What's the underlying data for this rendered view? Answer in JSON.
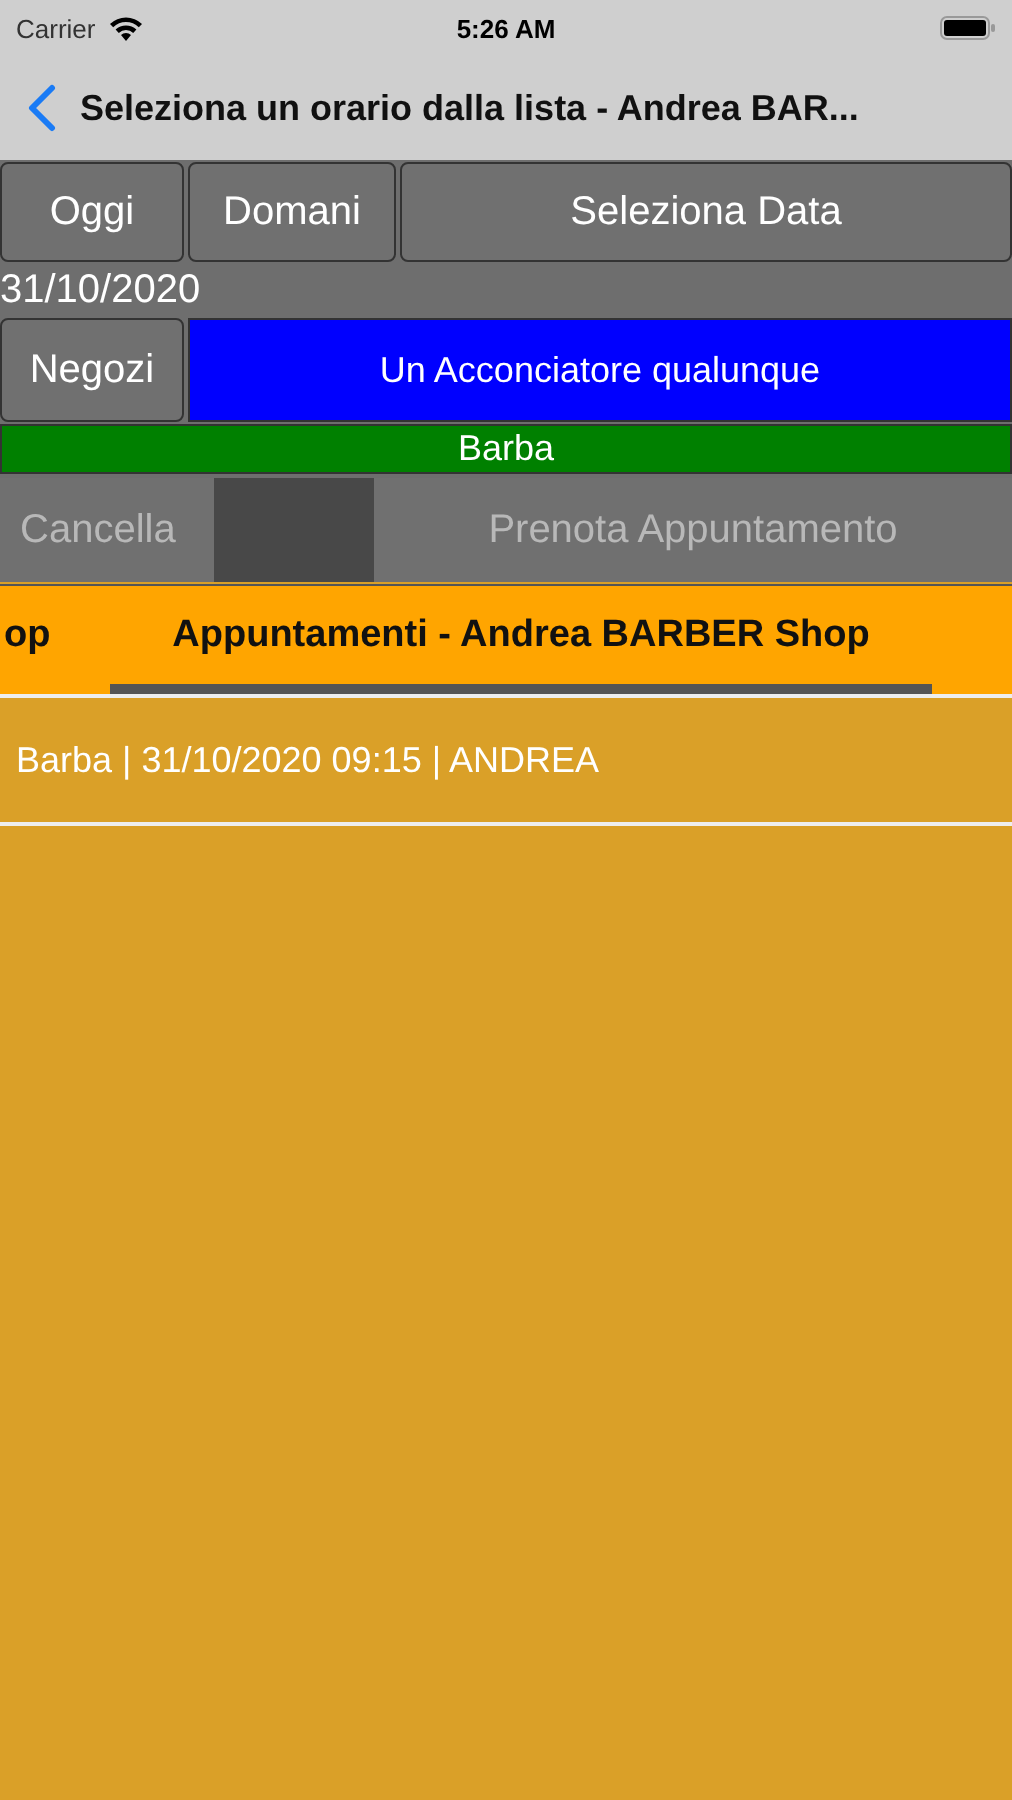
{
  "status_bar": {
    "carrier": "Carrier",
    "time": "5:26 AM"
  },
  "nav": {
    "title": "Seleziona un orario dalla lista - Andrea BAR..."
  },
  "day_buttons": [
    "Oggi",
    "Domani",
    "Seleziona Data"
  ],
  "selected_date": "31/10/2020",
  "shop_button": "Negozi",
  "barber": {
    "label": "Un Acconciatore qualunque",
    "color": "#0000ff"
  },
  "service": {
    "label": "Barba",
    "color": "#008000"
  },
  "actions": [
    {
      "label": "Cancella",
      "disabled": true
    },
    {
      "label": "Prenota Appuntamento",
      "disabled": true
    }
  ],
  "tabs": [
    {
      "label": "op",
      "selected": false
    },
    {
      "label": "Appuntamenti - Andrea BARBER Shop",
      "selected": true
    }
  ],
  "appointments": [
    "Barba | 31/10/2020 09:15 | ANDREA"
  ]
}
